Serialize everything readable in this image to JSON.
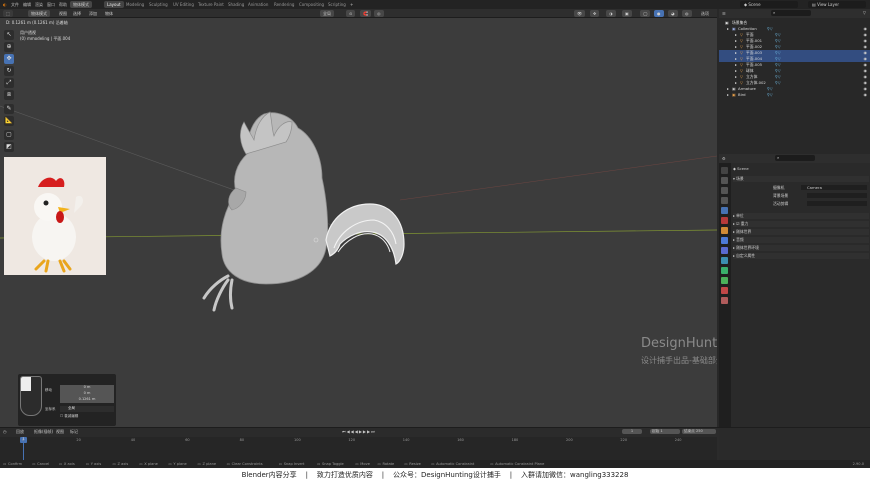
{
  "topbar": {
    "menus": [
      "文件",
      "编辑",
      "渲染",
      "窗口",
      "帮助"
    ],
    "workspaces": [
      "Layout",
      "Modeling",
      "Sculpting",
      "UV Editing",
      "Texture Paint",
      "Shading",
      "Animation",
      "Rendering",
      "Compositing",
      "Scripting"
    ],
    "active_workspace": "Layout",
    "scene": "Scene",
    "view_layer": "View Layer",
    "mode_button": "物体模式"
  },
  "viewport_header": {
    "mode": "物体模式",
    "view_menu": "视图",
    "select_menu": "选择",
    "add_menu": "添加",
    "object_menu": "物体",
    "transform": "全局",
    "pivot": "选项"
  },
  "viewport": {
    "view_info": "用户透视",
    "collection_info": "(0) mmodeling | 平面.004",
    "info_line": "D: 0.1261 m (0.1261 m) 沿着轴",
    "watermark_title": "DesignHunting",
    "watermark_sub": "设计捕手出品-基础部分",
    "redo_panel": {
      "label1": "移动",
      "x": "0 m",
      "y": "0 m",
      "z": "0.1261 m",
      "orient_label": "坐标系",
      "orient": "全局",
      "proportional": "衰减编辑"
    }
  },
  "outliner": {
    "header": "场景集合",
    "rows": [
      {
        "label": "Collection",
        "indent": 1,
        "selected": false
      },
      {
        "label": "平面",
        "indent": 2,
        "selected": false
      },
      {
        "label": "平面.001",
        "indent": 2,
        "selected": false
      },
      {
        "label": "平面.002",
        "indent": 2,
        "selected": false
      },
      {
        "label": "平面.003",
        "indent": 2,
        "selected": true
      },
      {
        "label": "平面.004",
        "indent": 2,
        "selected": true
      },
      {
        "label": "平面.005",
        "indent": 2,
        "selected": false
      },
      {
        "label": "球体",
        "indent": 2,
        "selected": false
      },
      {
        "label": "立方体",
        "indent": 2,
        "selected": false
      },
      {
        "label": "立方体.002",
        "indent": 2,
        "selected": false
      },
      {
        "label": "Armature",
        "indent": 1,
        "selected": false
      },
      {
        "label": "Bird",
        "indent": 1,
        "selected": false
      }
    ]
  },
  "properties": {
    "title": "Scene",
    "section_scene": "场景",
    "camera_label": "摄像机",
    "camera_value": "Camera",
    "bg_scene_label": "背景场景",
    "active_clip_label": "活动剪辑",
    "sections": [
      "单位",
      "重力",
      "刚体世界",
      "音频",
      "刚体世界环境",
      "自定义属性"
    ]
  },
  "timeline": {
    "menus": [
      "回放",
      "抠像(插帧)",
      "视图",
      "标记"
    ],
    "current_frame": "1",
    "start_label": "起始",
    "start": "1",
    "end_label": "结束点",
    "end": "250",
    "ticks": [
      "0",
      "20",
      "40",
      "60",
      "80",
      "100",
      "120",
      "140",
      "160",
      "180",
      "200",
      "220",
      "240"
    ]
  },
  "statusbar": {
    "items": [
      "Confirm",
      "Cancel",
      "X axis",
      "Y axis",
      "Z axis",
      "X plane",
      "Y plane",
      "Z plane",
      "Clear Constraints",
      "Snap Invert",
      "Snap Toggle",
      "Move",
      "Rotate",
      "Resize",
      "Automatic Constraint",
      "Automatic Constraint Plane"
    ],
    "version": "2.90.0"
  },
  "footer": {
    "text": "Blender内容分享    |    致力打造优质内容    |    公众号：DesignHunting设计捕手    |    入群请加微信：wangling333228"
  },
  "colors": {
    "accent": "#4772b3",
    "selected_row": "#334d80",
    "viewport_bg": "#3c3c3c",
    "x_axis": "#b5534a",
    "y_axis": "#8aa232"
  }
}
